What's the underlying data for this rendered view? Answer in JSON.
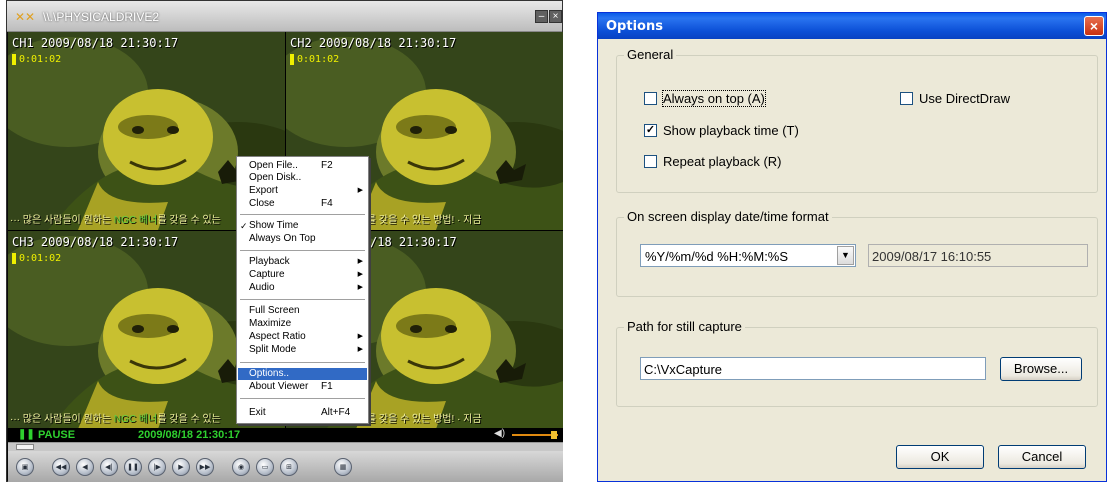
{
  "player": {
    "title": "\\\\.\\PHYSICALDRIVE2",
    "channels": [
      {
        "label": "CH1 2009/08/18 21:30:17",
        "time": "0:01:02"
      },
      {
        "label": "CH2 2009/08/18 21:30:17",
        "time": "0:01:02"
      },
      {
        "label": "CH3 2009/08/18 21:30:17",
        "time": "0:01:02"
      },
      {
        "label": "/18 21:30:17",
        "time": ""
      }
    ],
    "status": {
      "state": "PAUSE",
      "datetime": "2009/08/18 21:30:17"
    }
  },
  "menu": {
    "open_file": "Open File..",
    "open_file_sc": "F2",
    "open_disk": "Open Disk..",
    "export": "Export",
    "close": "Close",
    "close_sc": "F4",
    "show_time": "Show Time",
    "always_on_top": "Always On Top",
    "playback": "Playback",
    "capture": "Capture",
    "audio": "Audio",
    "full_screen": "Full Screen",
    "maximize": "Maximize",
    "aspect_ratio": "Aspect Ratio",
    "split_mode": "Split Mode",
    "options": "Options..",
    "about": "About Viewer",
    "about_sc": "F1",
    "exit": "Exit",
    "exit_sc": "Alt+F4"
  },
  "options": {
    "title": "Options",
    "general": {
      "title": "General",
      "always_on_top": "Always on top (A)",
      "always_on_top_checked": false,
      "use_directdraw": "Use DirectDraw",
      "use_directdraw_checked": false,
      "show_playback_time": "Show playback time (T)",
      "show_playback_time_checked": true,
      "repeat_playback": "Repeat playback (R)",
      "repeat_playback_checked": false
    },
    "osd": {
      "title": "On screen display date/time format",
      "format": "%Y/%m/%d %H:%M:%S",
      "preview": "2009/08/17 16:10:55"
    },
    "capture": {
      "title": "Path for still capture",
      "path": "C:\\VxCapture",
      "browse": "Browse..."
    },
    "ok": "OK",
    "cancel": "Cancel"
  }
}
